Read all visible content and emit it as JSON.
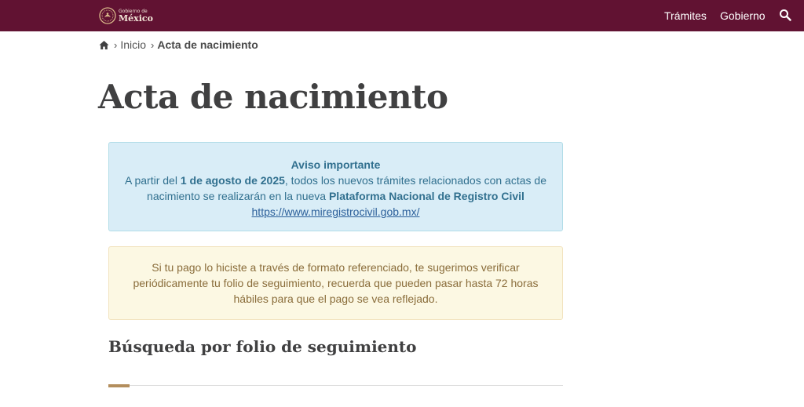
{
  "header": {
    "logo": {
      "line1": "Gobierno de",
      "line2": "México"
    },
    "nav": [
      {
        "label": "Trámites"
      },
      {
        "label": "Gobierno"
      }
    ],
    "icons": {
      "search": "search-icon",
      "emblem": "coat-of-arms-icon"
    },
    "colors": {
      "background": "#611232"
    }
  },
  "breadcrumb": {
    "home_icon": "home-icon",
    "items": [
      {
        "label": "Inicio"
      },
      {
        "label": "Acta de nacimiento"
      }
    ]
  },
  "page": {
    "title": "Acta de nacimiento"
  },
  "alert_info": {
    "title": "Aviso importante",
    "text_before": "A partir del ",
    "date": "1 de agosto de 2025",
    "text_middle": ", todos los nuevos trámites relacionados con actas de nacimiento se realizarán en la nueva ",
    "platform": "Plataforma Nacional de Registro Civil",
    "link": "https://www.miregistrocivil.gob.mx/"
  },
  "alert_warning": {
    "text": "Si tu pago lo hiciste a través de formato referenciado, te sugerimos verificar periódicamente tu folio de seguimiento, recuerda que pueden pasar hasta 72 horas hábiles para que el pago se vea reflejado."
  },
  "section": {
    "title": "Búsqueda por folio de seguimiento"
  },
  "colors": {
    "brand": "#611232",
    "accent": "#b38e5d",
    "info_bg": "#d9edf7",
    "warning_bg": "#fcf8e3"
  }
}
